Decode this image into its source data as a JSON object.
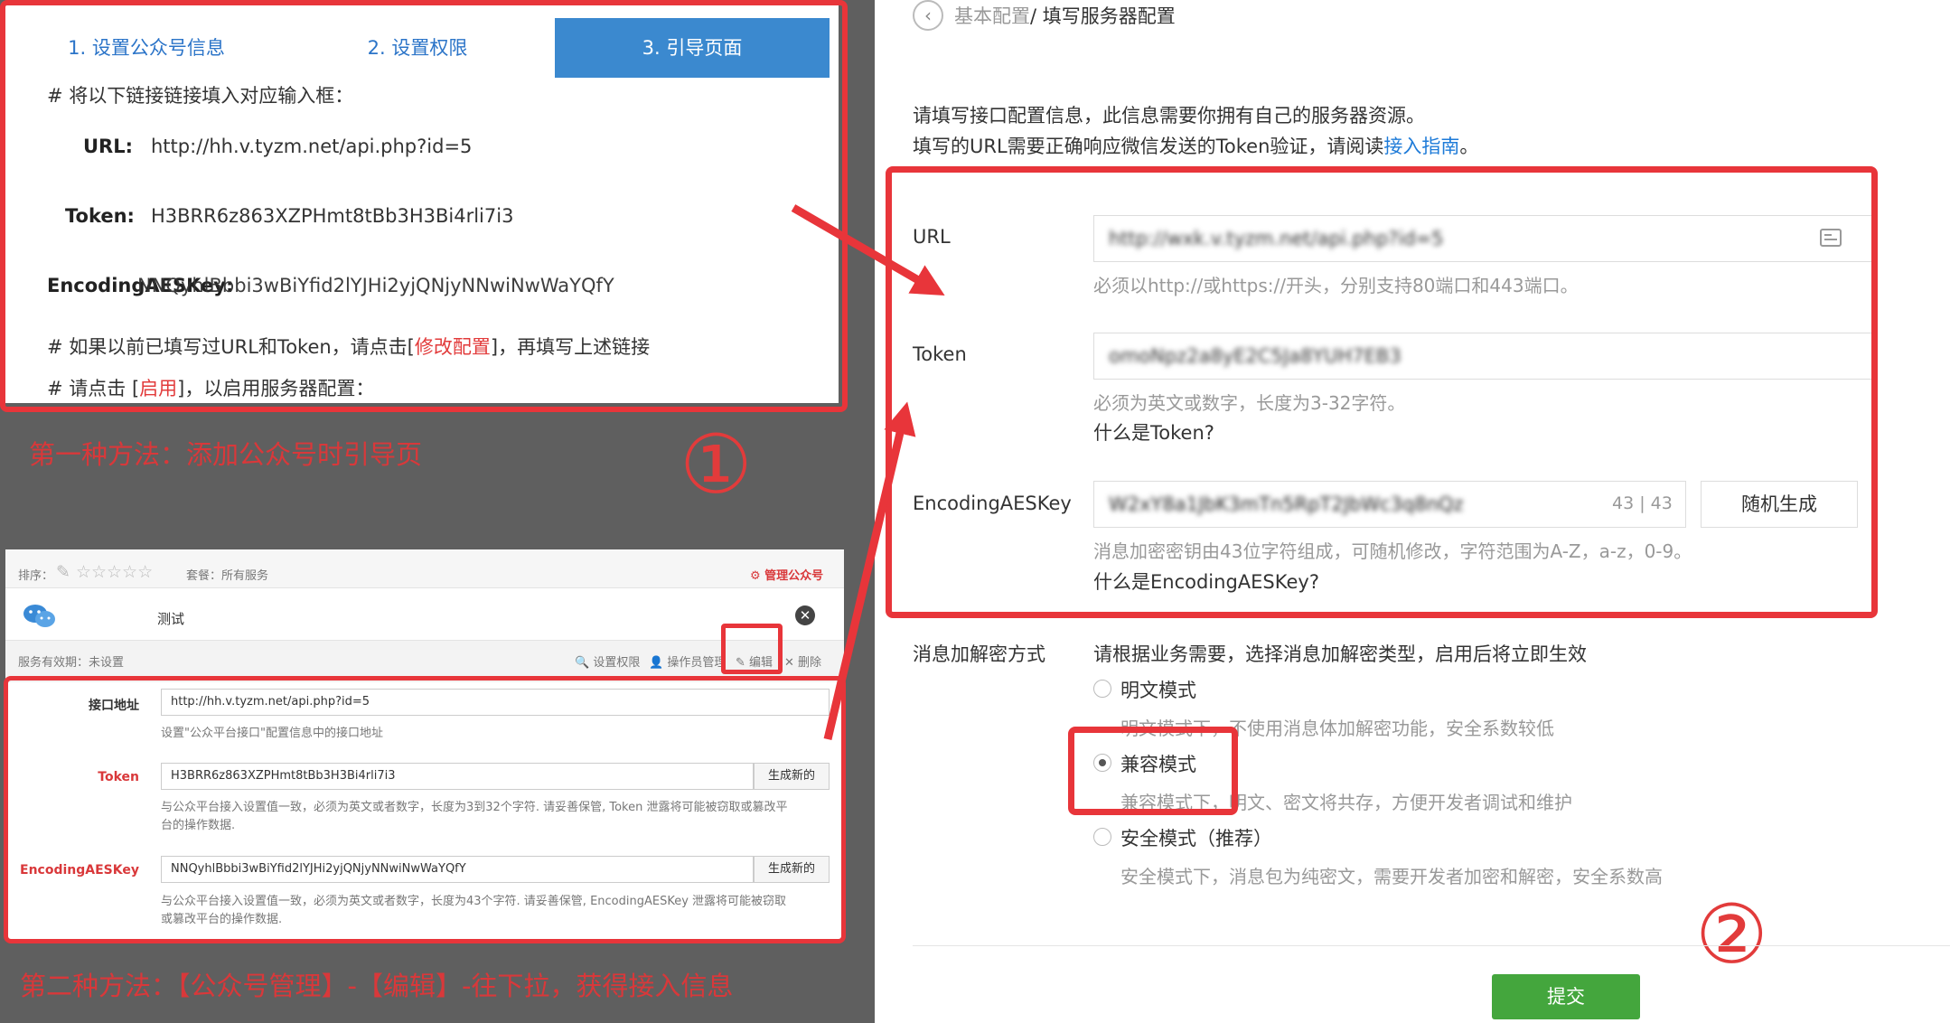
{
  "card1": {
    "tabs": [
      {
        "label": "1. 设置公众号信息",
        "active": false
      },
      {
        "label": "2. 设置权限",
        "active": false
      },
      {
        "label": "3. 引导页面",
        "active": true
      }
    ],
    "instruction": "# 将以下链接链接填入对应输入框：",
    "url_label": "URL:",
    "url_value": "http://hh.v.tyzm.net/api.php?id=5",
    "token_label": "Token:",
    "token_value": "H3BRR6z863XZPHmt8tBb3H3Bi4rli7i3",
    "aes_label": "EncodingAESKey:",
    "aes_value": "NNQyhlBbbi3wBiYfid2lYJHi2yjQNjyNNwiNwWaYQfY",
    "note1_prefix": "# 如果以前已填写过URL和Token，请点击[",
    "note1_link": "修改配置",
    "note1_suffix": "]，再填写上述链接",
    "note2_prefix": "# 请点击 [",
    "note2_link": "启用",
    "note2_suffix": "]，以启用服务器配置："
  },
  "caption1": "第一种方法：添加公众号时引导页",
  "circled1": "①",
  "card2": {
    "sort_label": "排序：",
    "package_label": "套餐：所有服务",
    "manage_link": "⚙ 管理公众号",
    "account_name": "测试",
    "service_period": "服务有效期：未设置",
    "actions": {
      "set_permission": "设置权限",
      "operators": "操作员管理",
      "edit": "编辑",
      "delete": "删除"
    },
    "interface_label": "接口地址",
    "interface_value": "http://hh.v.tyzm.net/api.php?id=5",
    "interface_hint": "设置\"公众平台接口\"配置信息中的接口地址",
    "token_label": "Token",
    "token_value": "H3BRR6z863XZPHmt8tBb3H3Bi4rli7i3",
    "token_gen": "生成新的",
    "token_hint1": "与公众平台接入设置值一致，必须为英文或者数字，长度为3到32个字符. 请妥善保管, Token 泄露将可能被窃取或篡改平",
    "token_hint2": "台的操作数据.",
    "aes_label": "EncodingAESKey",
    "aes_value": "NNQyhlBbbi3wBiYfid2lYJHi2yjQNjyNNwiNwWaYQfY",
    "aes_gen": "生成新的",
    "aes_hint1": "与公众平台接入设置值一致，必须为英文或者数字，长度为43个字符. 请妥善保管, EncodingAESKey 泄露将可能被窃取",
    "aes_hint2": "或篡改平台的操作数据."
  },
  "caption2": "第二种方法：【公众号管理】-【编辑】-往下拉，获得接入信息",
  "right": {
    "breadcrumb_prefix": "基本配置",
    "breadcrumb_current": "/ 填写服务器配置",
    "intro1": "请填写接口配置信息，此信息需要你拥有自己的服务器资源。",
    "intro2_prefix": "填写的URL需要正确响应微信发送的Token验证，请阅读",
    "intro2_link": "接入指南",
    "intro2_suffix": "。",
    "url_label": "URL",
    "url_value": "http://wxk.v.tyzm.net/api.php?id=5",
    "url_hint": "必须以http://或https://开头，分别支持80端口和443端口。",
    "token_label": "Token",
    "token_value": "omoNpz2a8yE2C5Ja8YUH7EB3",
    "token_hint": "必须为英文或数字，长度为3-32字符。",
    "token_help": "什么是Token?",
    "aes_label": "EncodingAESKey",
    "aes_value": "W2xY8a1JbK3mTn5RpT2JbWc3q8nQz",
    "aes_counter": "43 | 43",
    "aes_random": "随机生成",
    "aes_hint": "消息加密密钥由43位字符组成，可随机修改，字符范围为A-Z，a-z，0-9。",
    "aes_help": "什么是EncodingAESKey?",
    "mode_label": "消息加解密方式",
    "mode_desc": "请根据业务需要，选择消息加解密类型，启用后将立即生效",
    "modes": [
      {
        "label": "明文模式",
        "desc": "明文模式下，不使用消息体加解密功能，安全系数较低",
        "checked": false
      },
      {
        "label": "兼容模式",
        "desc": "兼容模式下，明文、密文将共存，方便开发者调试和维护",
        "checked": true
      },
      {
        "label": "安全模式（推荐）",
        "desc": "安全模式下，消息包为纯密文，需要开发者加密和解密，安全系数高",
        "checked": false
      }
    ],
    "submit": "提交"
  },
  "circled2": "②",
  "colors": {
    "accent_red": "#e8353a",
    "link_blue": "#1e7bd8",
    "tab_blue": "#3b89cf",
    "submit_green": "#44a63d"
  }
}
